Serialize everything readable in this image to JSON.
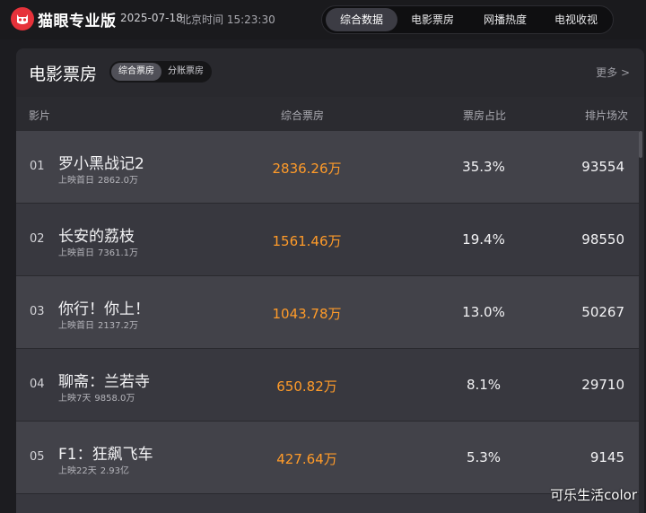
{
  "app": {
    "logo_text": "猫眼专业版",
    "date": "2025-07-18",
    "time_label": "北京时间",
    "time": "15:23:30"
  },
  "nav": {
    "tabs": [
      {
        "label": "综合数据",
        "active": true
      },
      {
        "label": "电影票房",
        "active": false
      },
      {
        "label": "网播热度",
        "active": false
      },
      {
        "label": "电视收视",
        "active": false
      }
    ]
  },
  "panel": {
    "title": "电影票房",
    "subtabs": [
      {
        "label": "综合票房",
        "active": true
      },
      {
        "label": "分账票房",
        "active": false
      }
    ],
    "more_label": "更多 >",
    "columns": {
      "film": "影片",
      "box_office": "综合票房",
      "ratio": "票房占比",
      "shows": "排片场次"
    },
    "rows": [
      {
        "rank": "01",
        "title": "罗小黑战记2",
        "sub_label": "上映首日",
        "sub_value": "2862.0万",
        "box_office": "2836.26万",
        "ratio": "35.3%",
        "shows": "93554"
      },
      {
        "rank": "02",
        "title": "长安的荔枝",
        "sub_label": "上映首日",
        "sub_value": "7361.1万",
        "box_office": "1561.46万",
        "ratio": "19.4%",
        "shows": "98550"
      },
      {
        "rank": "03",
        "title": "你行！你上！",
        "sub_label": "上映首日",
        "sub_value": "2137.2万",
        "box_office": "1043.78万",
        "ratio": "13.0%",
        "shows": "50267"
      },
      {
        "rank": "04",
        "title": "聊斋：兰若寺",
        "sub_label": "上映7天",
        "sub_value": "9858.0万",
        "box_office": "650.82万",
        "ratio": "8.1%",
        "shows": "29710"
      },
      {
        "rank": "05",
        "title": "F1：狂飙飞车",
        "sub_label": "上映22天",
        "sub_value": "2.93亿",
        "box_office": "427.64万",
        "ratio": "5.3%",
        "shows": "9145"
      }
    ]
  },
  "watermark": "可乐生活color",
  "colors": {
    "accent": "#ff9b29",
    "logo_red": "#e6323a",
    "background": "#1c1c20",
    "panel": "#29292e"
  },
  "icons": {
    "logo": "cat-eye-logo-icon",
    "more": "chevron-right-icon"
  }
}
